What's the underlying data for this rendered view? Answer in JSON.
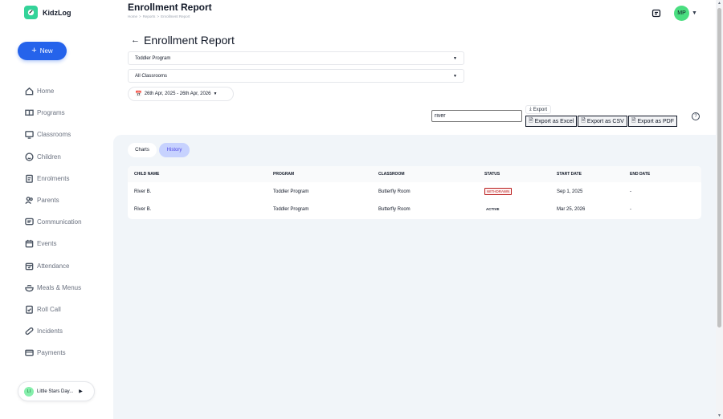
{
  "app": {
    "name": "KidzLog",
    "new_label": "New",
    "colors": {
      "primary": "#2563eb",
      "accent": "#34d399",
      "withdrawn": "#b91c1c"
    }
  },
  "sidebar": {
    "items": [
      {
        "label": "Home",
        "icon": "home-icon"
      },
      {
        "label": "Programs",
        "icon": "book-icon"
      },
      {
        "label": "Classrooms",
        "icon": "monitor-icon"
      },
      {
        "label": "Children",
        "icon": "face-icon"
      },
      {
        "label": "Enrolments",
        "icon": "clipboard-icon"
      },
      {
        "label": "Parents",
        "icon": "users-icon"
      },
      {
        "label": "Communication",
        "icon": "message-icon"
      },
      {
        "label": "Events",
        "icon": "calendar-icon"
      },
      {
        "label": "Attendance",
        "icon": "calendar-check-icon"
      },
      {
        "label": "Meals & Menus",
        "icon": "meal-icon"
      },
      {
        "label": "Roll Call",
        "icon": "checklist-icon"
      },
      {
        "label": "Incidents",
        "icon": "bandage-icon"
      },
      {
        "label": "Payments",
        "icon": "card-icon"
      }
    ],
    "school": {
      "initials": "LI",
      "name": "Little Stars Day..."
    }
  },
  "header": {
    "title": "Enrollment Report",
    "breadcrumbs": [
      "Home",
      "Reports",
      "Enrollment Report"
    ],
    "user_initials": "MP"
  },
  "report": {
    "title": "Enrollment Report",
    "program_select": "Toddler Program",
    "classroom_select": "All Classrooms",
    "date_range": "26th Apr, 2025 - 26th Apr, 2026",
    "search_value": "river",
    "export_label": "Export",
    "export_excel": "Export as Excel",
    "export_csv": "Export as CSV",
    "export_pdf": "Export as PDF"
  },
  "tabs": {
    "charts": "Charts",
    "history": "History"
  },
  "table": {
    "columns": [
      "CHILD NAME",
      "PROGRAM",
      "CLASSROOM",
      "STATUS",
      "START DATE",
      "END DATE"
    ],
    "rows": [
      {
        "child": "River B.",
        "program": "Toddler Program",
        "classroom": "Butterfly Room",
        "status": "WITHDRAWN",
        "start": "Sep 1, 2025",
        "end": "-"
      },
      {
        "child": "River B.",
        "program": "Toddler Program",
        "classroom": "Butterfly Room",
        "status": "ACTIVE",
        "start": "Mar 25, 2026",
        "end": "-"
      }
    ]
  }
}
